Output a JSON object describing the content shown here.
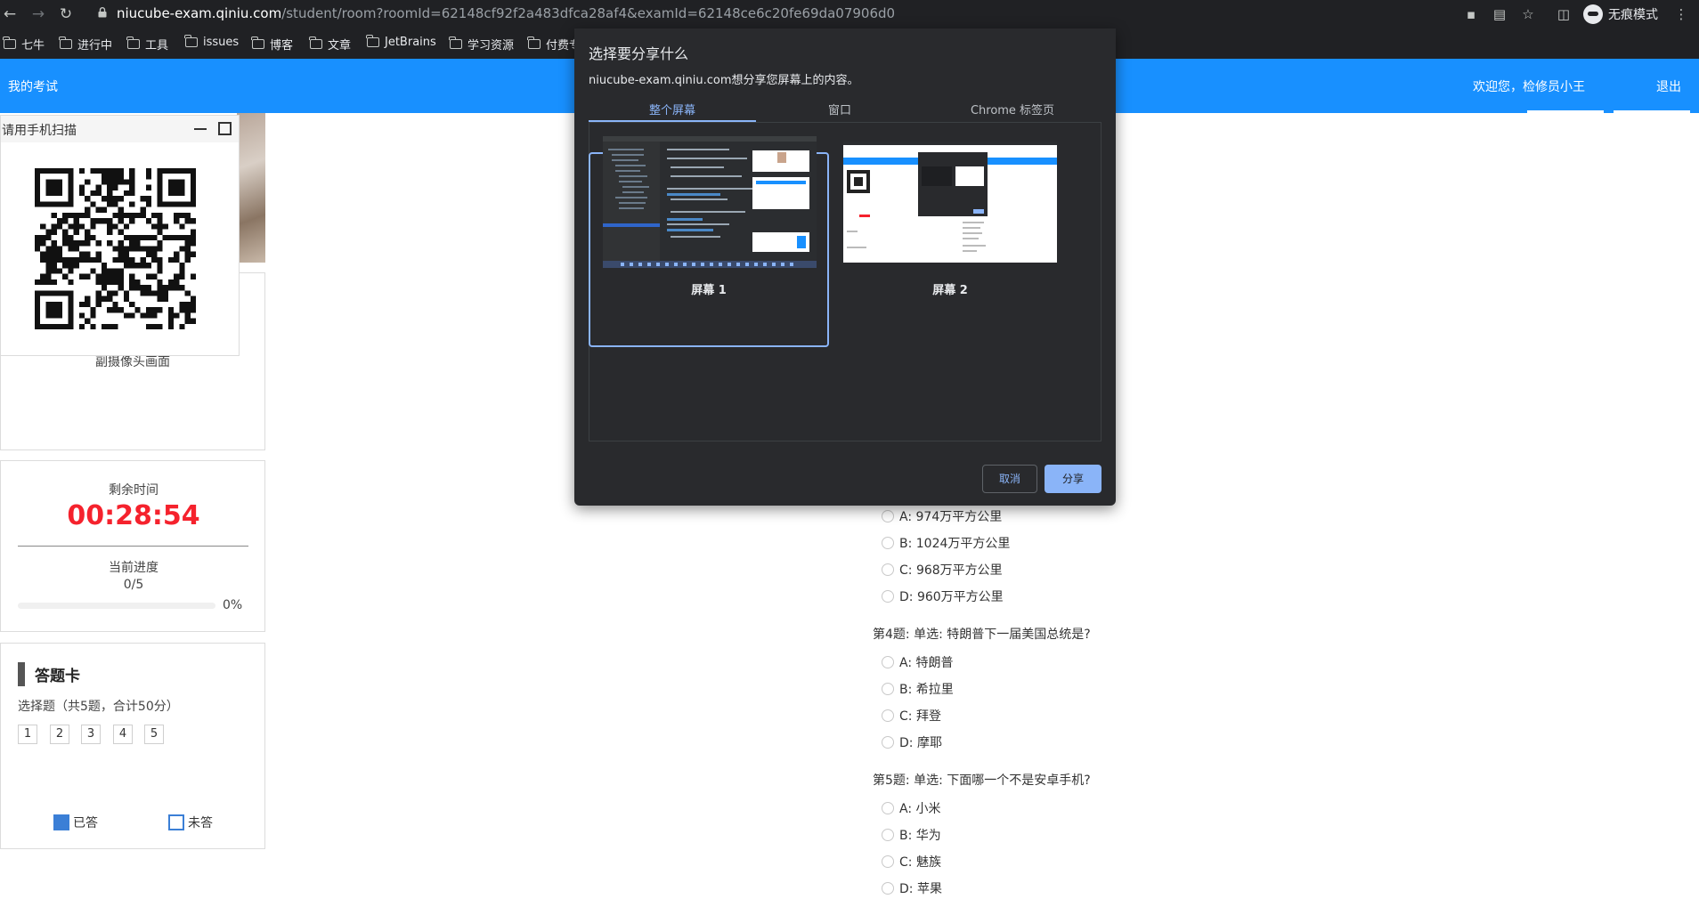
{
  "browser": {
    "url_host": "niucube-exam.qiniu.com",
    "url_path": "/student/room?roomId=62148cf92f2a483dfca28af4&examId=62148ce6c20fe69da07906d0",
    "incognito_label": "无痕模式",
    "bookmarks": [
      "七牛",
      "进行中",
      "工具",
      "issues",
      "博客",
      "文章",
      "JetBrains",
      "学习资源",
      "付费专"
    ]
  },
  "header": {
    "title": "我的考试",
    "welcome": "欢迎您，检修员小王",
    "logout": "退出",
    "color": "#1890ff"
  },
  "qr_popup": {
    "title": "请用手机扫描"
  },
  "camera": {
    "sub_label": "副摄像头画面"
  },
  "timer": {
    "label": "剩余时间",
    "value": "00:28:54",
    "progress_label": "当前进度",
    "progress_count": "0/5",
    "progress_percent_text": "0%",
    "progress_fraction": 0,
    "value_color": "#f5222d"
  },
  "answer_card": {
    "title": "答题卡",
    "subtitle": "选择题（共5题，合计50分）",
    "numbers": [
      "1",
      "2",
      "3",
      "4",
      "5"
    ],
    "legend_answered": "已答",
    "legend_unanswered": "未答"
  },
  "questions": {
    "q3_options": [
      "A: 974万平方公里",
      "B: 1024万平方公里",
      "C: 968万平方公里",
      "D: 960万平方公里"
    ],
    "q4": {
      "title": "第4题: 单选: 特朗普下一届美国总统是?",
      "options": [
        "A: 特朗普",
        "B: 希拉里",
        "C: 拜登",
        "D: 摩耶"
      ]
    },
    "q5": {
      "title": "第5题: 单选: 下面哪一个不是安卓手机?",
      "options": [
        "A: 小米",
        "B: 华为",
        "C: 魅族",
        "D: 苹果"
      ]
    }
  },
  "share_dialog": {
    "title": "选择要分享什么",
    "description": "niucube-exam.qiniu.com想分享您屏幕上的内容。",
    "tabs": [
      "整个屏幕",
      "窗口",
      "Chrome 标签页"
    ],
    "active_tab": "整个屏幕",
    "screens": [
      "屏幕 1",
      "屏幕 2"
    ],
    "selected_screen": "屏幕 1",
    "cancel": "取消",
    "share": "分享",
    "accent": "#8ab4f8"
  }
}
